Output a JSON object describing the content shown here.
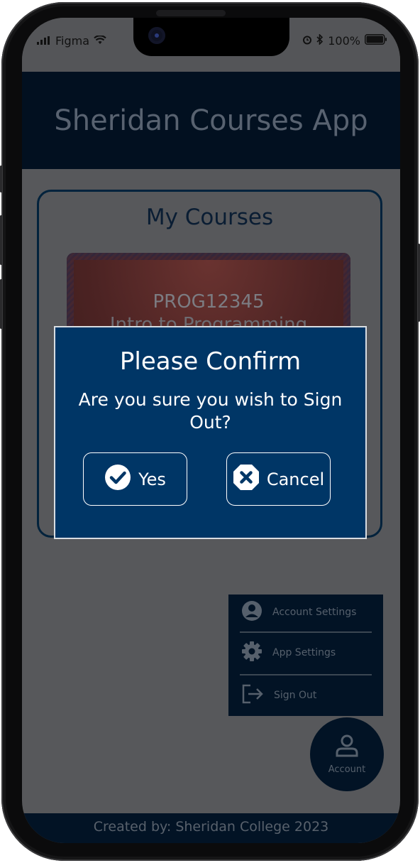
{
  "status_bar": {
    "carrier": "Figma",
    "battery": "100%"
  },
  "app": {
    "title": "Sheridan Courses App"
  },
  "courses_card": {
    "title": "My Courses",
    "course": {
      "code": "PROG12345",
      "name": "Intro to Programming"
    }
  },
  "account_menu": {
    "items": [
      {
        "label": "Account Settings",
        "icon": "account-circle-icon"
      },
      {
        "label": "App Settings",
        "icon": "gear-icon"
      },
      {
        "label": "Sign Out",
        "icon": "sign-out-icon"
      }
    ]
  },
  "account_fab": {
    "label": "Account",
    "icon": "person-icon"
  },
  "footer": {
    "text": "Created by: Sheridan College 2023"
  },
  "dialog": {
    "title": "Please Confirm",
    "message": "Are you sure you wish to Sign Out?",
    "yes_label": "Yes",
    "cancel_label": "Cancel"
  },
  "colors": {
    "dialog_bg": "#003666",
    "appbar_bg": "#021020",
    "overlay_bg": "#57585b"
  }
}
